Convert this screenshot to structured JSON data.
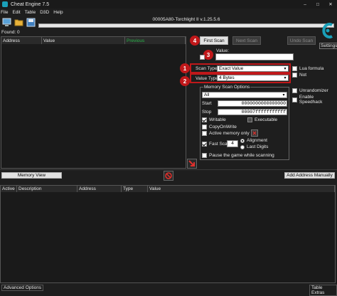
{
  "window": {
    "title": "Cheat Engine 7.5"
  },
  "menu": [
    "File",
    "Edit",
    "Table",
    "D3D",
    "Help"
  ],
  "process_title": "00005A80-Torchlight II v.1.25.5.6",
  "found_label": "Found: 0",
  "results_columns": [
    "Address",
    "Value",
    "Previous"
  ],
  "scan_buttons": {
    "first": "First Scan",
    "next": "Next Scan",
    "undo": "Undo Scan"
  },
  "settings_label": "Settings",
  "value_label": "Value:",
  "markers": {
    "m1": "1",
    "m2": "2",
    "m3": "3",
    "m4": "4"
  },
  "scan_type": {
    "label": "Scan Type",
    "value": "Exact Value"
  },
  "value_type": {
    "label": "Value Type",
    "value": "4 Bytes"
  },
  "right_options": {
    "lua": "Lua formula",
    "not": "Not",
    "unrandomizer": "Unrandomizer",
    "speedhack": "Enable Speedhack"
  },
  "memory_options": {
    "title": "Memory Scan Options",
    "region": "All",
    "start_label": "Start",
    "start_value": "0000000000000000",
    "stop_label": "Stop",
    "stop_value": "00007fffffffffff",
    "writable": "Writable",
    "executable": "Executable",
    "copyonwrite": "CopyOnWrite",
    "active_only": "Active memory only",
    "fast_scan": "Fast Scan",
    "fast_scan_value": "4",
    "alignment": "Alignment",
    "last_digits": "Last Digits",
    "pause": "Pause the game while scanning"
  },
  "memory_view_button": "Memory View",
  "add_address_button": "Add Address Manually",
  "table_columns": [
    "Active",
    "Description",
    "Address",
    "Type",
    "Value"
  ],
  "bottom": {
    "advanced": "Advanced Options",
    "extras": "Table Extras"
  },
  "colors": {
    "previous_header": "#29b34a",
    "accent_red": "#c0181a",
    "logo_teal": "#1a9fb8"
  }
}
